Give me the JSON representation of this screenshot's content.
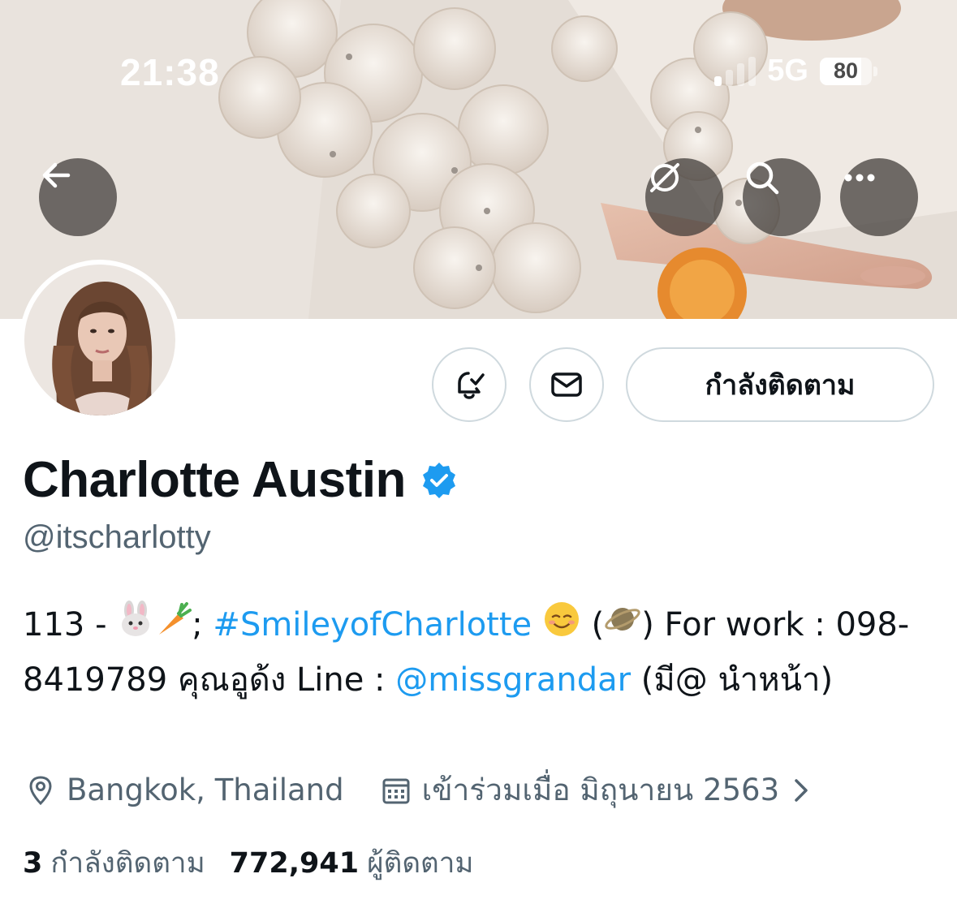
{
  "status_bar": {
    "time": "21:38",
    "network": "5G",
    "battery_text": "80",
    "battery_level": 0.8,
    "signal_bars_on": 1
  },
  "header_buttons": {
    "back_icon": "arrow-left-icon",
    "unsubscribe_icon": "cancel-circle-icon",
    "search_icon": "search-icon",
    "more_icon": "more-horizontal-icon"
  },
  "profile": {
    "display_name": "Charlotte Austin",
    "verified": true,
    "handle": "@itscharlotty",
    "follow_button_label": "กำลังติดตาม",
    "notify_icon": "bell-check-icon",
    "message_icon": "envelope-icon"
  },
  "bio": {
    "part1": "113 - ",
    "part2": "; ",
    "hashtag": "#SmileyofCharlotte",
    "part3": " ",
    "part4": " (",
    "part5": ") For work : 098-8419789 คุณอูด้ง Line : ",
    "mention": "@missgrandar",
    "part6": " (มี@ นำหน้า)"
  },
  "meta": {
    "location": "Bangkok, Thailand",
    "joined": "เข้าร่วมเมื่อ มิถุนายน 2563"
  },
  "stats": {
    "following_count": "3",
    "following_label": "กำลังติดตาม",
    "followers_count": "772,941",
    "followers_label": "ผู้ติดตาม"
  },
  "colors": {
    "link": "#1d9bf0",
    "verified": "#1d9bf0",
    "secondary_text": "#536471"
  }
}
